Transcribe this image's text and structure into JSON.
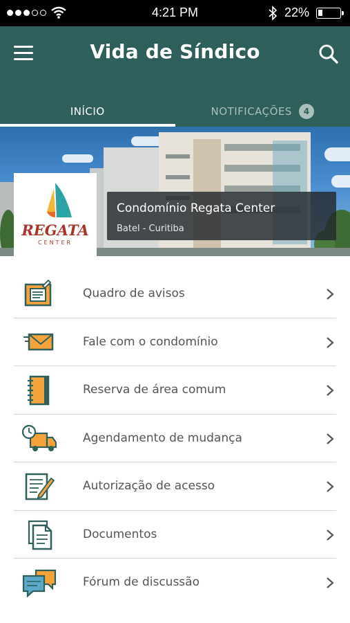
{
  "status_bar": {
    "time": "4:21 PM",
    "battery_percent": "22%",
    "battery_level": 0.22,
    "signal_bars_filled": 3,
    "signal_bars_total": 5
  },
  "header": {
    "title": "Vida de Síndico",
    "menu_icon": "hamburger-menu-icon",
    "search_icon": "search-icon",
    "background_color": "#2f5f5a"
  },
  "tabs": [
    {
      "label": "INÍCIO",
      "active": true
    },
    {
      "label": "NOTIFICAÇÕES",
      "active": false,
      "badge": "4"
    }
  ],
  "condo": {
    "logo_text": "REGATA",
    "logo_subtext": "CENTER",
    "name": "Condomínio Regata Center",
    "location": "Batel - Curitiba"
  },
  "menu": [
    {
      "label": "Quadro de avisos",
      "icon": "notice-board-icon"
    },
    {
      "label": "Fale com o condomínio",
      "icon": "mail-envelope-icon"
    },
    {
      "label": "Reserva de área comum",
      "icon": "notebook-icon"
    },
    {
      "label": "Agendamento de mudança",
      "icon": "moving-truck-clock-icon"
    },
    {
      "label": "Autorização de acesso",
      "icon": "document-pen-icon"
    },
    {
      "label": "Documentos",
      "icon": "documents-icon"
    },
    {
      "label": "Fórum de discussão",
      "icon": "chat-bubbles-icon"
    }
  ],
  "colors": {
    "primary": "#2f5f5a",
    "icon_orange": "#f5a33b",
    "icon_teal": "#2f5f5a",
    "logo_red": "#a7352a"
  }
}
